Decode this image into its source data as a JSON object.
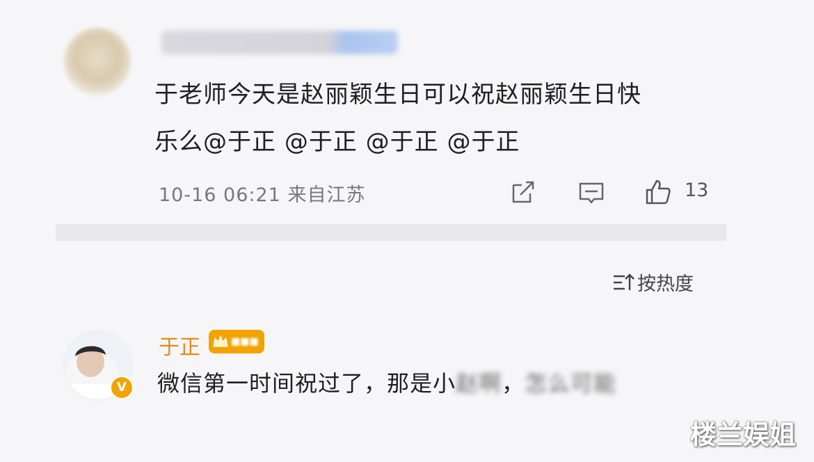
{
  "post": {
    "text_line1": "于老师今天是赵丽颖生日可以祝赵丽颖生日快",
    "text_line2_prefix": "乐么",
    "mentions": [
      "@于正",
      "@于正",
      "@于正",
      "@于正"
    ],
    "timestamp": "10-16 06:21",
    "location": "来自江苏",
    "like_count": "13"
  },
  "sort": {
    "label": "按热度"
  },
  "reply": {
    "author": "于正",
    "verified_icon": "v-badge",
    "text_visible": "微信第一时间祝过了，那是小",
    "text_blurred_1": "赵啊",
    "text_mid": "，",
    "text_blurred_2": "怎么可能"
  },
  "watermark": "楼兰娱姐",
  "colors": {
    "author": "#e58a1c",
    "badge": "#f2a300"
  }
}
